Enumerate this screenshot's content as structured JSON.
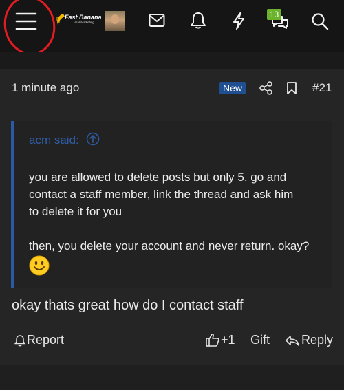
{
  "header": {
    "brand_name": "Fast Banana",
    "brand_sub": "Viral Marketing",
    "conversations_badge": "13",
    "icons": [
      "menu-icon",
      "brand-logo",
      "avatar",
      "envelope-icon",
      "bell-icon",
      "bolt-icon",
      "chat-bubbles-icon",
      "search-icon"
    ]
  },
  "post": {
    "time": "1 minute ago",
    "new_badge": "New",
    "number": "#21",
    "quote": {
      "author": "acm said:",
      "line1": "you are allowed to delete posts but only 5. go and",
      "line2": "contact a staff member, link the thread and ask him",
      "line3": "to delete it for you",
      "line4": "then, you delete your account and never return. okay?"
    },
    "message": "okay thats great how do I contact staff",
    "actions": {
      "report": "Report",
      "like": "+1",
      "gift": "Gift",
      "reply": "Reply"
    }
  },
  "colors": {
    "accent_blue": "#1f4e91",
    "quote_bar": "#2a5aa5",
    "badge_green": "#6ab32a",
    "annotation_red": "#e21c22"
  }
}
